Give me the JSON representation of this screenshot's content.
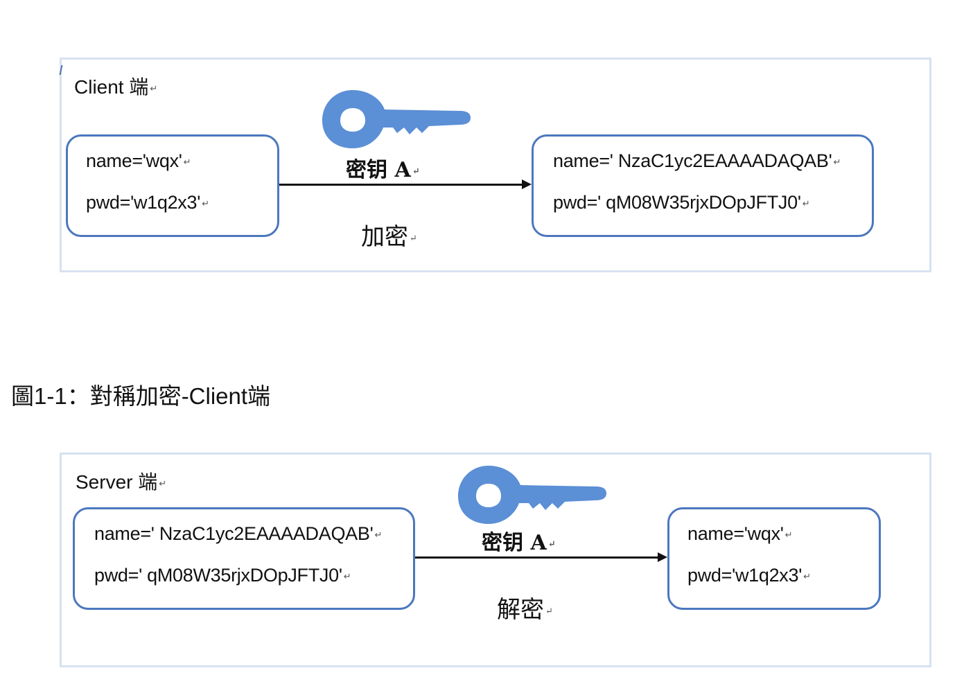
{
  "client": {
    "label": "Client 端",
    "left_box": {
      "name": "name='wqx'",
      "pwd": "pwd='w1q2x3'"
    },
    "right_box": {
      "name": "name=' NzaC1yc2EAAAADAQAB'",
      "pwd": "pwd=' qM08W35rjxDOpJFTJ0'"
    },
    "key_label": "密钥 A",
    "operation": "加密"
  },
  "caption": "圖1-1：對稱加密-Client端",
  "server": {
    "label": "Server 端",
    "left_box": {
      "name": "name=' NzaC1yc2EAAAADAQAB'",
      "pwd": "pwd=' qM08W35rjxDOpJFTJ0'"
    },
    "right_box": {
      "name": "name='wqx'",
      "pwd": "pwd='w1q2x3'"
    },
    "key_label": "密钥 A",
    "operation": "解密"
  },
  "colors": {
    "box_border": "#4b77be",
    "key": "#5b8fd6",
    "panel_border": "#d7e2f0"
  },
  "icons": {
    "key": "key-icon",
    "return_mark": "↵"
  }
}
